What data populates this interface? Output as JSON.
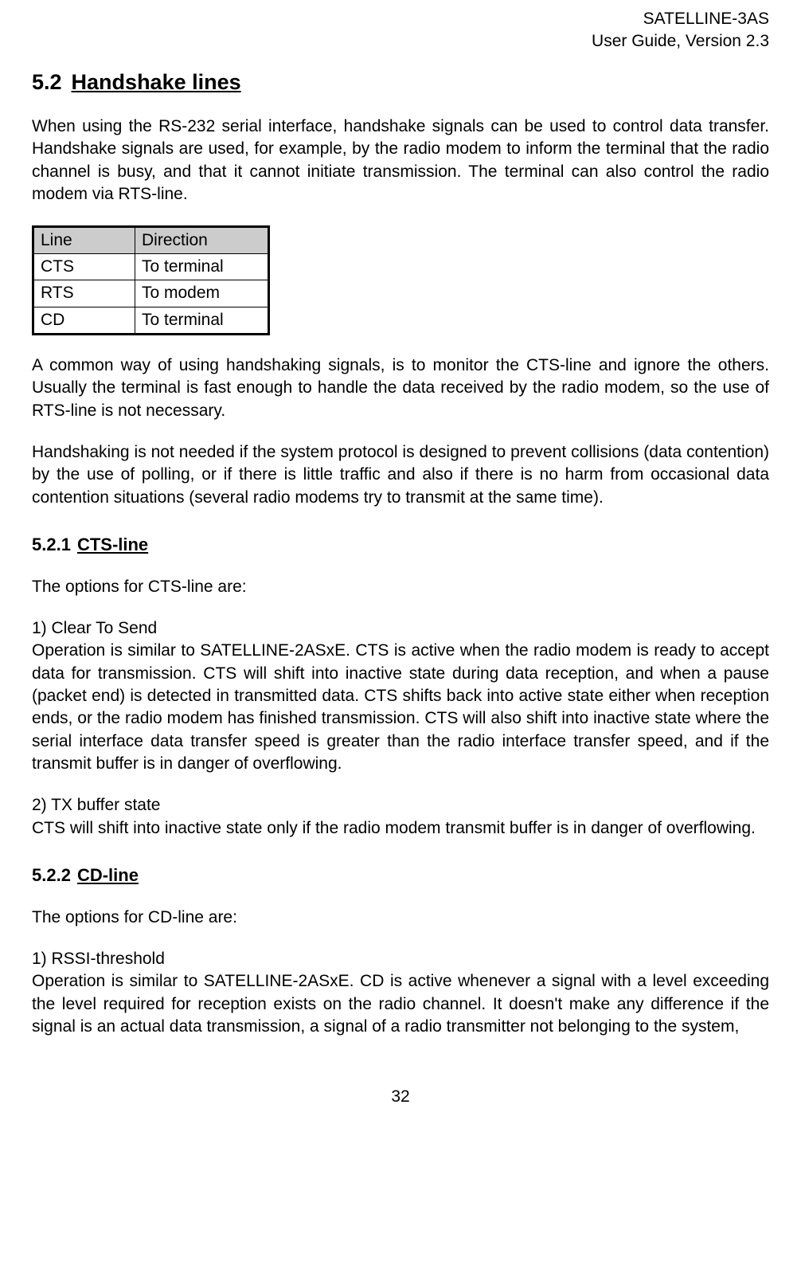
{
  "header": {
    "line1": "SATELLINE-3AS",
    "line2": "User Guide, Version 2.3"
  },
  "h2": {
    "num": "5.2",
    "title": "Handshake lines"
  },
  "p1": "When using the RS-232 serial interface, handshake signals can be used to control data transfer. Handshake signals are used, for example, by the radio modem to inform the terminal that the radio channel is busy, and that it cannot initiate transmission. The terminal can also control the radio modem via RTS-line.",
  "table": {
    "h1": "Line",
    "h2": "Direction",
    "rows": [
      {
        "c1": "CTS",
        "c2": "To terminal"
      },
      {
        "c1": "RTS",
        "c2": "To modem"
      },
      {
        "c1": "CD",
        "c2": "To terminal"
      }
    ]
  },
  "p2": "A common way of using handshaking signals, is to monitor the CTS-line and ignore the others. Usually the terminal is fast enough to handle the data received by the radio modem, so the use of RTS-line is not necessary.",
  "p3": "Handshaking is not needed if the system protocol is designed to prevent collisions (data contention) by the use of polling, or if there is little traffic and also if there is no harm from occasional data contention situations (several radio modems try to transmit at the same time).",
  "s521": {
    "num": "5.2.1",
    "title": "CTS-line",
    "intro": "The options for CTS-line are:",
    "opt1label": "1) Clear To Send",
    "opt1body": "Operation is similar to SATELLINE-2ASxE. CTS is active when the radio modem is ready to accept data for transmission. CTS will shift into inactive state during data reception, and when a pause (packet end) is detected in transmitted data. CTS shifts back into active state either when reception ends, or the radio modem has finished transmission. CTS will also shift into inactive state where the serial interface data transfer speed is greater than the radio interface transfer speed, and if the transmit buffer is in danger of overflowing.",
    "opt2label": "2) TX buffer state",
    "opt2body": "CTS will shift into inactive state only if the radio modem transmit buffer is in danger of overflowing."
  },
  "s522": {
    "num": "5.2.2",
    "title": "CD-line",
    "intro": "The options for CD-line are:",
    "opt1label": "1) RSSI-threshold",
    "opt1body": "Operation is similar to SATELLINE-2ASxE. CD is active whenever a signal with a level exceeding the level required for reception exists on the radio channel. It doesn't make any difference if the signal is an actual data transmission, a signal of a radio transmitter not belonging to the system,"
  },
  "pagenum": "32"
}
